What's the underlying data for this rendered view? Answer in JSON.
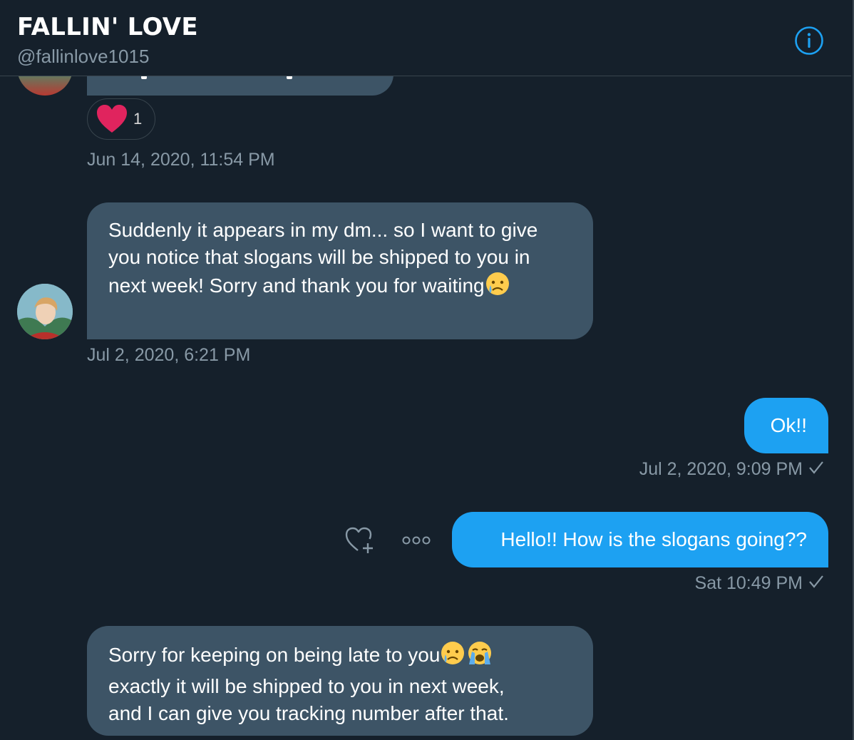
{
  "header": {
    "title": "FALLIN' LOVE",
    "handle": "@fallinlove1015",
    "info_icon": "info-circle-icon"
  },
  "colors": {
    "background": "#15202b",
    "incoming_bubble": "#3d5466",
    "outgoing_bubble": "#1da1f2",
    "muted_text": "#8899a6",
    "heart": "#e0245e"
  },
  "messages": {
    "m1": {
      "reaction_icon": "heart-icon",
      "reaction_count": "1",
      "timestamp": "Jun 14, 2020, 11:54 PM"
    },
    "m2": {
      "text": "Suddenly it appears in my dm... so I want to give you notice that slogans will be shipped to you in next week! Sorry and thank you for waiting",
      "emoji": "crying-face-icon",
      "timestamp": "Jul 2, 2020, 6:21 PM"
    },
    "m3": {
      "text": "Ok!!",
      "timestamp": "Jul 2, 2020, 9:09 PM",
      "status_icon": "checkmark-icon"
    },
    "m4": {
      "text": "Hello!! How is the slogans going??",
      "timestamp": "Sat 10:49 PM",
      "status_icon": "checkmark-icon",
      "actions": [
        "add-reaction-icon",
        "more-options-icon"
      ]
    },
    "m5": {
      "line1": "Sorry for keeping on being late to you",
      "line2": "exactly it will be shipped to you in next week,",
      "line3": "and I can give you tracking number after that.",
      "emojis": [
        "crying-face-icon",
        "loudly-crying-face-icon"
      ]
    }
  }
}
